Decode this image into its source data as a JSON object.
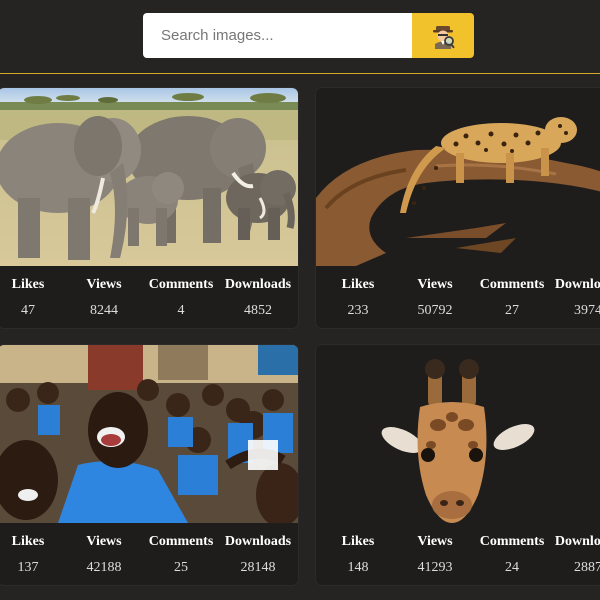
{
  "search": {
    "placeholder": "Search images...",
    "button_icon": "detective-icon"
  },
  "colors": {
    "background": "#252423",
    "accent": "#f2c22c",
    "card": "#1e1d1c"
  },
  "stat_labels": {
    "likes": "Likes",
    "views": "Views",
    "comments": "Comments",
    "downloads": "Downloads"
  },
  "cards": [
    {
      "subject": "elephants",
      "likes": "47",
      "views": "8244",
      "comments": "4",
      "downloads": "4852"
    },
    {
      "subject": "leopard",
      "likes": "233",
      "views": "50792",
      "comments": "27",
      "downloads": "3974"
    },
    {
      "subject": "children",
      "likes": "137",
      "views": "42188",
      "comments": "25",
      "downloads": "28148"
    },
    {
      "subject": "giraffe",
      "likes": "148",
      "views": "41293",
      "comments": "24",
      "downloads": "2887"
    }
  ]
}
